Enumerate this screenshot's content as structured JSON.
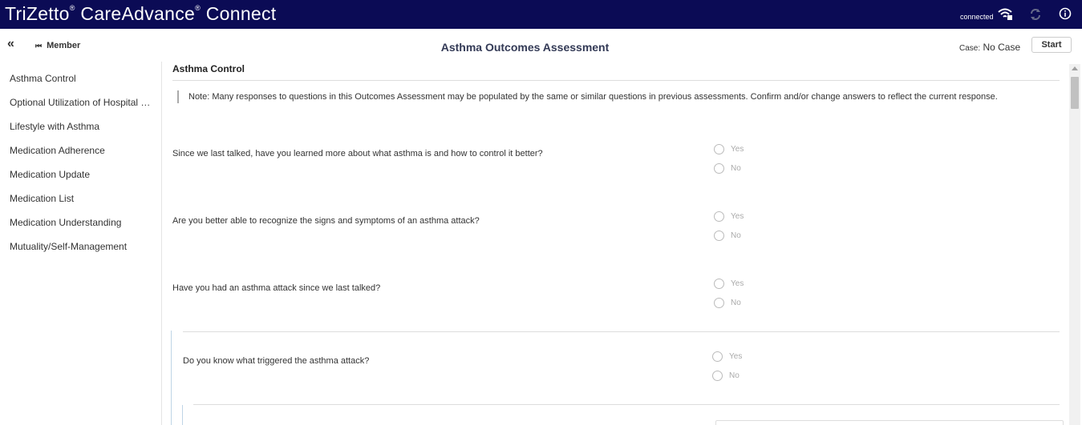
{
  "header": {
    "brand_part1": "TriZetto",
    "brand_part2": "CareAdvance",
    "brand_part3": "Connect",
    "brand_mark": "®",
    "status": "connected",
    "bg_color": "#0b0b55"
  },
  "toolbar": {
    "member_label": "Member",
    "page_title": "Asthma Outcomes Assessment",
    "case_label": "Case:",
    "case_value": "No Case",
    "start_label": "Start"
  },
  "sidebar": {
    "items": [
      {
        "label": "Asthma Control"
      },
      {
        "label": "Optional Utilization of Hospital Services"
      },
      {
        "label": "Lifestyle with Asthma"
      },
      {
        "label": "Medication Adherence"
      },
      {
        "label": "Medication Update"
      },
      {
        "label": "Medication List"
      },
      {
        "label": "Medication Understanding"
      },
      {
        "label": "Mutuality/Self-Management"
      }
    ]
  },
  "main": {
    "section_title": "Asthma Control",
    "note": "Note: Many responses to questions in this Outcomes Assessment may be populated by the same or similar questions in previous assessments. Confirm and/or change answers to reflect the current response.",
    "questions": [
      {
        "text": "Since we last talked, have you learned more about what asthma is and how to control it better?",
        "options": [
          "Yes",
          "No"
        ]
      },
      {
        "text": "Are you better able to recognize the signs and symptoms of an asthma attack?",
        "options": [
          "Yes",
          "No"
        ]
      },
      {
        "text": "Have you had an asthma attack since we last talked?",
        "options": [
          "Yes",
          "No"
        ]
      },
      {
        "text": "Do you know what triggered the asthma attack?",
        "options": [
          "Yes",
          "No"
        ]
      }
    ]
  }
}
